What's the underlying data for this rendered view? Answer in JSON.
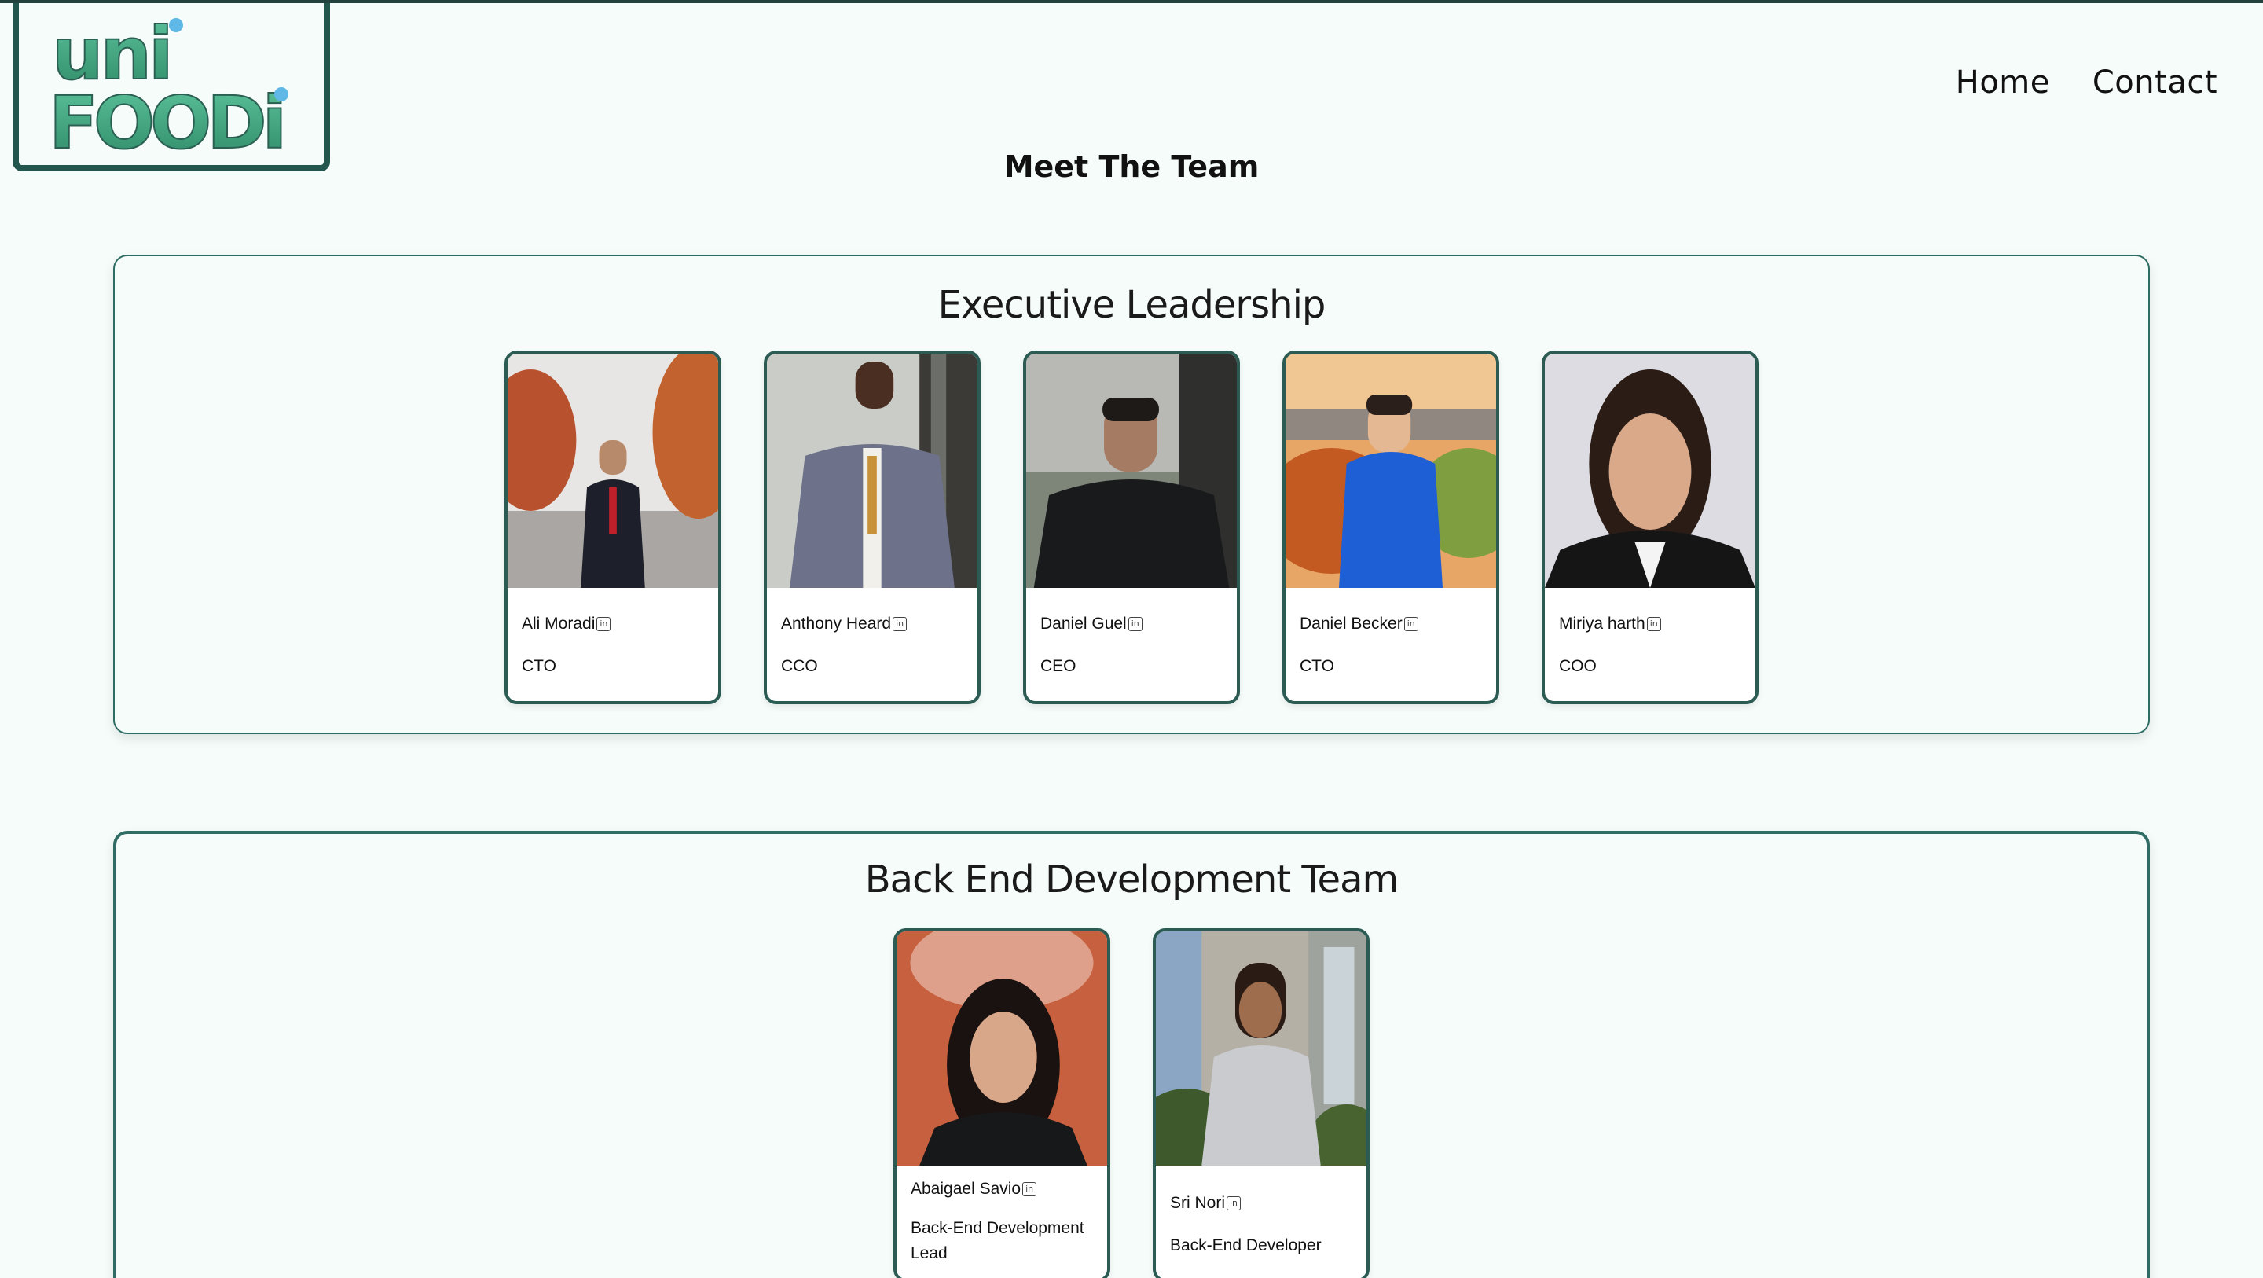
{
  "brand": {
    "line1": "uni",
    "line2": "FOODi",
    "main_color": "#3aa37e",
    "accent_color": "#5fb8e6"
  },
  "nav": {
    "home": "Home",
    "contact": "Contact"
  },
  "page_title": "Meet The Team",
  "sections": [
    {
      "title": "Executive Leadership",
      "members": [
        {
          "name": "Ali Moradi",
          "role": "CTO"
        },
        {
          "name": "Anthony Heard",
          "role": "CCO"
        },
        {
          "name": "Daniel Guel",
          "role": "CEO"
        },
        {
          "name": "Daniel Becker",
          "role": "CTO"
        },
        {
          "name": "Miriya harth",
          "role": "COO"
        }
      ]
    },
    {
      "title": "Back End Development Team",
      "members": [
        {
          "name": "Abaigael Savio",
          "role": "Back-End Development Lead"
        },
        {
          "name": "Sri Nori",
          "role": "Back-End Developer"
        }
      ]
    }
  ],
  "icons": {
    "linkedin": "linkedin-icon",
    "linkedin_glyph": "in"
  },
  "colors": {
    "border": "#2b5b53",
    "background": "#f6fcfa"
  }
}
